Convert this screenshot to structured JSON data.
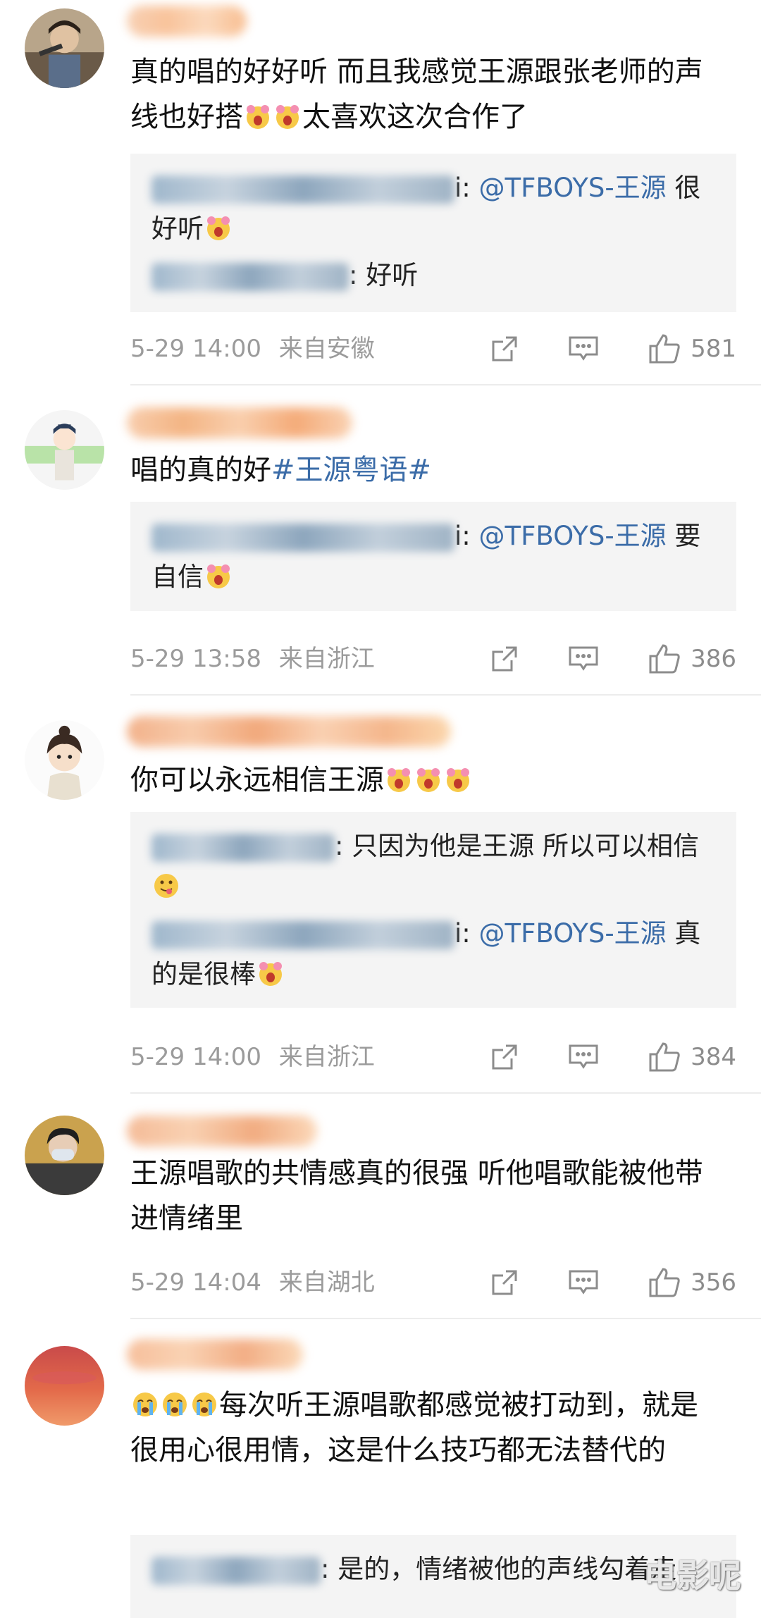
{
  "comments": [
    {
      "text": "真的唱的好好听 而且我感觉王源跟张老师的声线也好搭",
      "text_after": "太喜欢这次合作了",
      "replies": [
        {
          "suffix": "i: ",
          "mention": "@TFBOYS-王源",
          "text": " 很好听"
        },
        {
          "suffix": ": ",
          "mention": "",
          "text": "好听"
        }
      ],
      "timestamp": "5-29 14:00",
      "location": "来自安徽",
      "likes": "581"
    },
    {
      "text": "唱的真的好",
      "topic": "#王源粤语#",
      "replies": [
        {
          "suffix": "i: ",
          "mention": "@TFBOYS-王源",
          "text": " 要自信"
        }
      ],
      "timestamp": "5-29 13:58",
      "location": "来自浙江",
      "likes": "386"
    },
    {
      "text": "你可以永远相信王源",
      "replies": [
        {
          "suffix": ": ",
          "mention": "",
          "text": "只因为他是王源 所以可以相信"
        },
        {
          "suffix": "i: ",
          "mention": "@TFBOYS-王源",
          "text": " 真的是很棒"
        }
      ],
      "timestamp": "5-29 14:00",
      "location": "来自浙江",
      "likes": "384"
    },
    {
      "text": "王源唱歌的共情感真的很强 听他唱歌能被他带进情绪里",
      "timestamp": "5-29 14:04",
      "location": "来自湖北",
      "likes": "356"
    },
    {
      "text": "每次听王源唱歌都感觉被打动到，就是很用心很用情，这是什么技巧都无法替代的",
      "replies": [
        {
          "suffix": ": ",
          "mention": "",
          "text": "是的，情绪被他的声线勾着走"
        }
      ]
    }
  ],
  "watermark": "电影呢",
  "colors": {
    "link": "#3b6ca8",
    "meta": "#9b9b9b",
    "reply_bg": "#f4f4f4"
  }
}
